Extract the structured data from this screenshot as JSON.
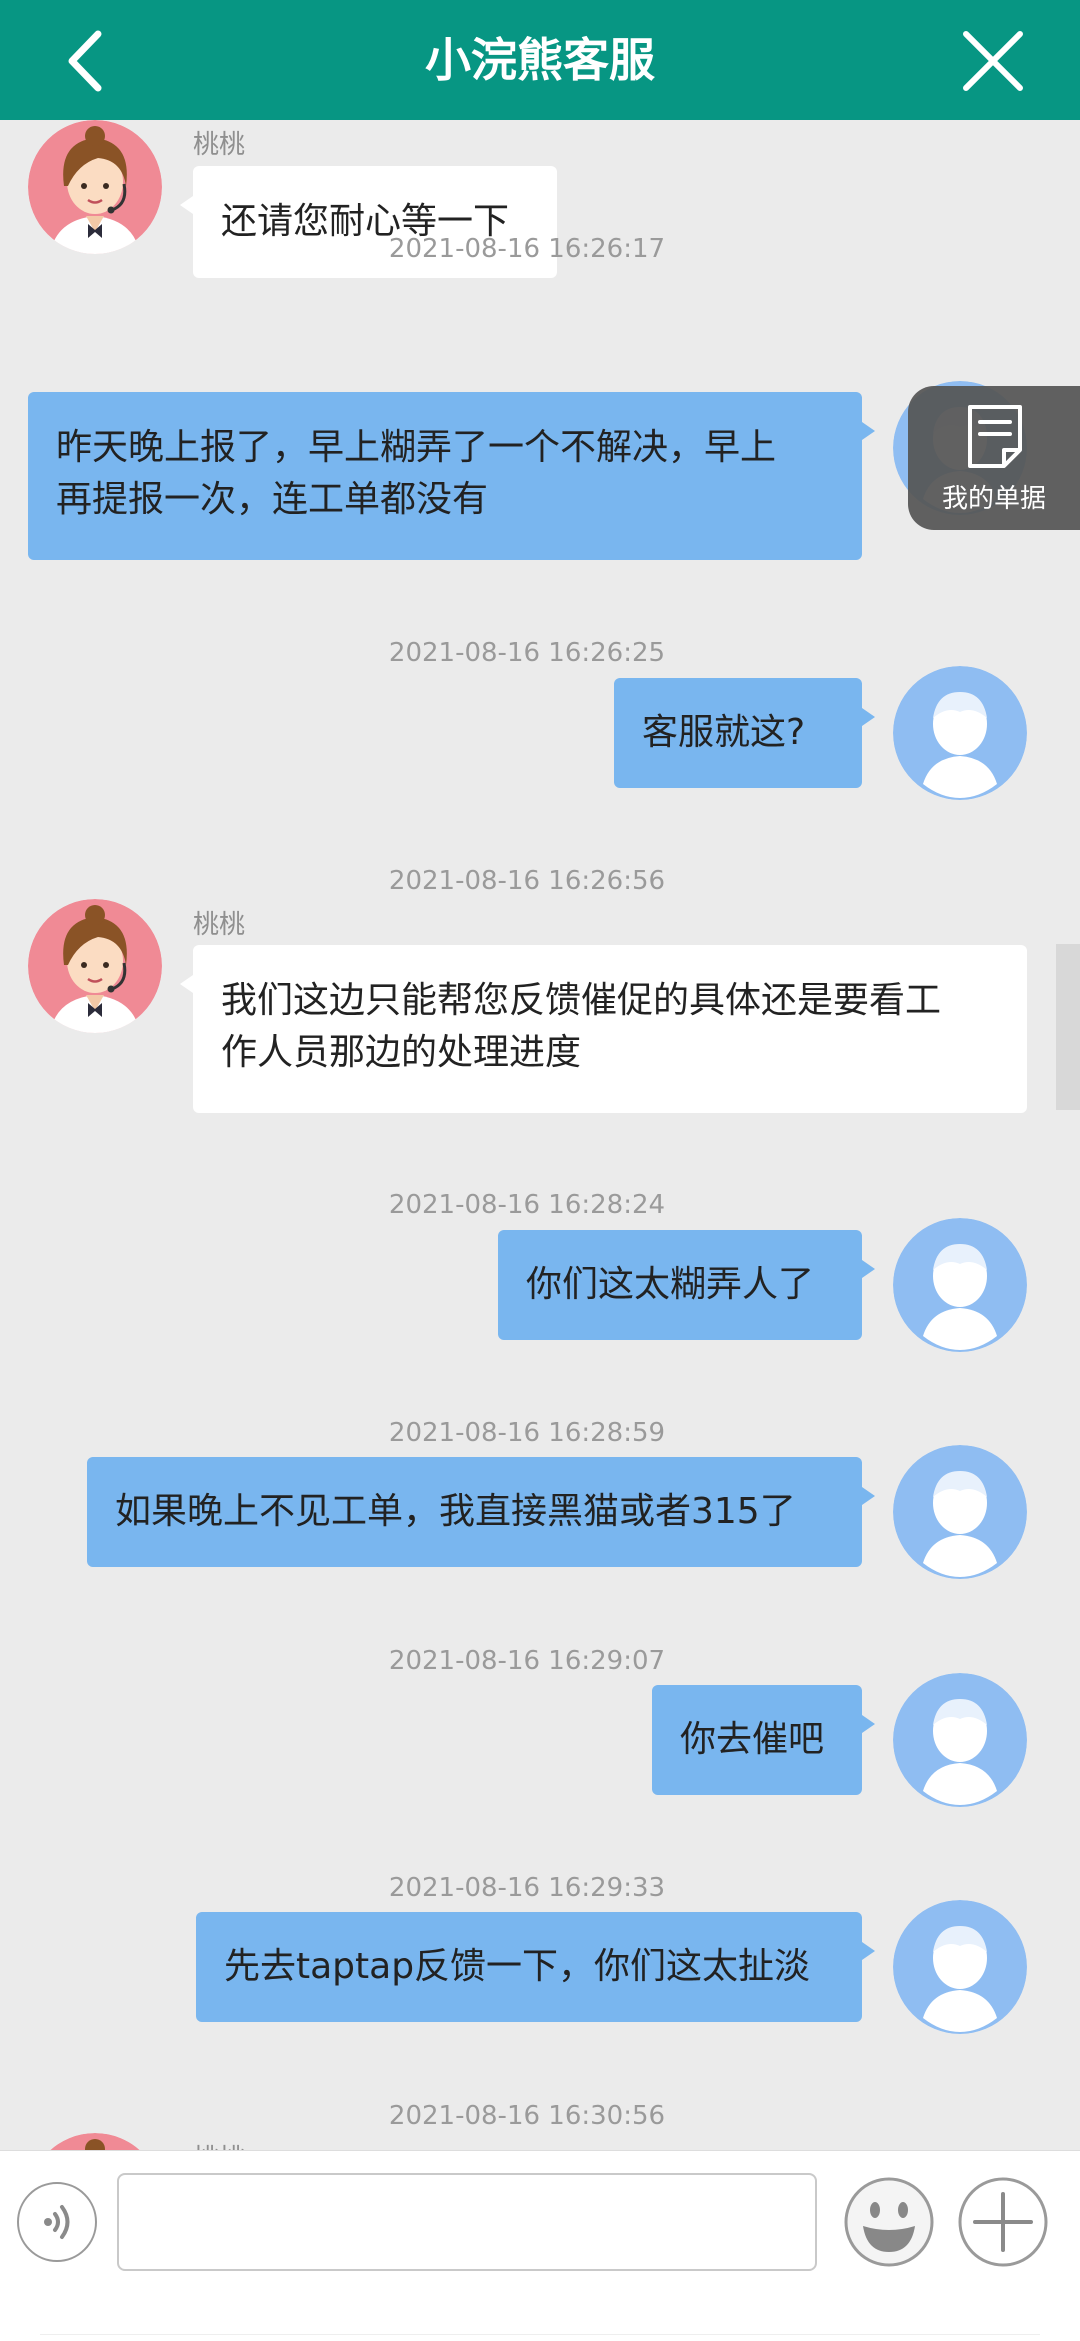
{
  "header": {
    "title": "小浣熊客服",
    "back_icon": "chevron-left-icon",
    "close_icon": "close-icon",
    "color": "#079683"
  },
  "floating_button": {
    "label": "我的单据",
    "icon": "document-icon"
  },
  "agent_name": "桃桃",
  "messages": [
    {
      "from": "agent",
      "name": "桃桃",
      "time": "",
      "lines": [
        "还请您耐心等一下"
      ]
    },
    {
      "from": "user",
      "time": "2021-08-16 16:26:17",
      "lines": [
        "昨天晚上报了，早上糊弄了一个不解决，早上",
        "再提报一次，连工单都没有"
      ]
    },
    {
      "from": "user",
      "time": "2021-08-16 16:26:25",
      "lines": [
        "客服就这?"
      ]
    },
    {
      "from": "agent",
      "name": "桃桃",
      "time": "2021-08-16 16:26:56",
      "lines": [
        "我们这边只能帮您反馈催促的具体还是要看工",
        "作人员那边的处理进度"
      ]
    },
    {
      "from": "user",
      "time": "2021-08-16 16:28:24",
      "lines": [
        "你们这太糊弄人了"
      ]
    },
    {
      "from": "user",
      "time": "2021-08-16 16:28:59",
      "lines": [
        "如果晚上不见工单，我直接黑猫或者315了"
      ]
    },
    {
      "from": "user",
      "time": "2021-08-16 16:29:07",
      "lines": [
        "你去催吧"
      ]
    },
    {
      "from": "user",
      "time": "2021-08-16 16:29:33",
      "lines": [
        "先去taptap反馈一下，你们这太扯淡"
      ]
    },
    {
      "from": "agent",
      "name": "桃桃",
      "time": "2021-08-16 16:30:56",
      "lines": []
    }
  ],
  "input_bar": {
    "placeholder": "",
    "voice_icon": "voice-icon",
    "emoji_icon": "emoji-icon",
    "plus_icon": "plus-icon"
  },
  "colors": {
    "user_bubble": "#79b6ef",
    "agent_bubble": "#ffffff",
    "background": "#ebebeb"
  }
}
